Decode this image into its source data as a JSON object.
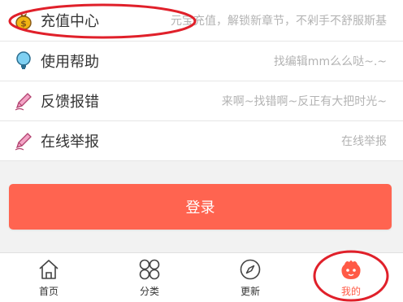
{
  "menu": {
    "items": [
      {
        "icon": "money-bag-icon",
        "label": "充值中心",
        "hint": "元宝充值，解锁新章节，不剁手不舒服斯基"
      },
      {
        "icon": "lightbulb-icon",
        "label": "使用帮助",
        "hint": "找编辑mm么么哒~.~"
      },
      {
        "icon": "pencil-icon",
        "label": "反馈报错",
        "hint": "来啊~找错啊~反正有大把时光~"
      },
      {
        "icon": "pencil-icon",
        "label": "在线举报",
        "hint": "在线举报"
      }
    ]
  },
  "login": {
    "label": "登录"
  },
  "tabbar": {
    "tabs": [
      {
        "icon": "home-icon",
        "label": "首页",
        "active": false
      },
      {
        "icon": "category-icon",
        "label": "分类",
        "active": false
      },
      {
        "icon": "compass-icon",
        "label": "更新",
        "active": false
      },
      {
        "icon": "mascot-icon",
        "label": "我的",
        "active": true
      }
    ]
  },
  "colors": {
    "accent": "#ff6450",
    "active_tab": "#ff5a46",
    "annotation": "#e0202a"
  }
}
